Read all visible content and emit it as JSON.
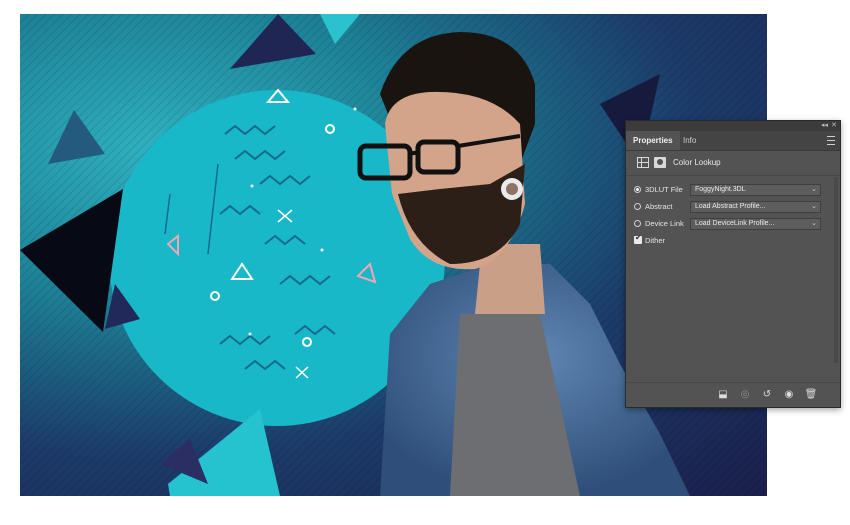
{
  "panel": {
    "tabs": [
      {
        "label": "Properties",
        "active": true
      },
      {
        "label": "Info",
        "active": false
      }
    ],
    "title": "Color Lookup",
    "collapse_glyph": "◂◂",
    "close_glyph": "✕",
    "rows": [
      {
        "label": "3DLUT File",
        "selected": true,
        "value": "FoggyNight.3DL"
      },
      {
        "label": "Abstract",
        "selected": false,
        "value": "Load Abstract Profile..."
      },
      {
        "label": "Device Link",
        "selected": false,
        "value": "Load DeviceLink Profile..."
      }
    ],
    "dither": {
      "label": "Dither",
      "checked": true
    },
    "footer_icons": [
      "clip-to-layer-icon",
      "view-previous-state-icon",
      "reset-icon",
      "visibility-eye-icon",
      "trash-icon"
    ]
  },
  "colors": {
    "panel_bg": "#535353",
    "panel_dark": "#3b3b3b",
    "teal": "#19b8c8",
    "navy": "#1b1f4a"
  }
}
